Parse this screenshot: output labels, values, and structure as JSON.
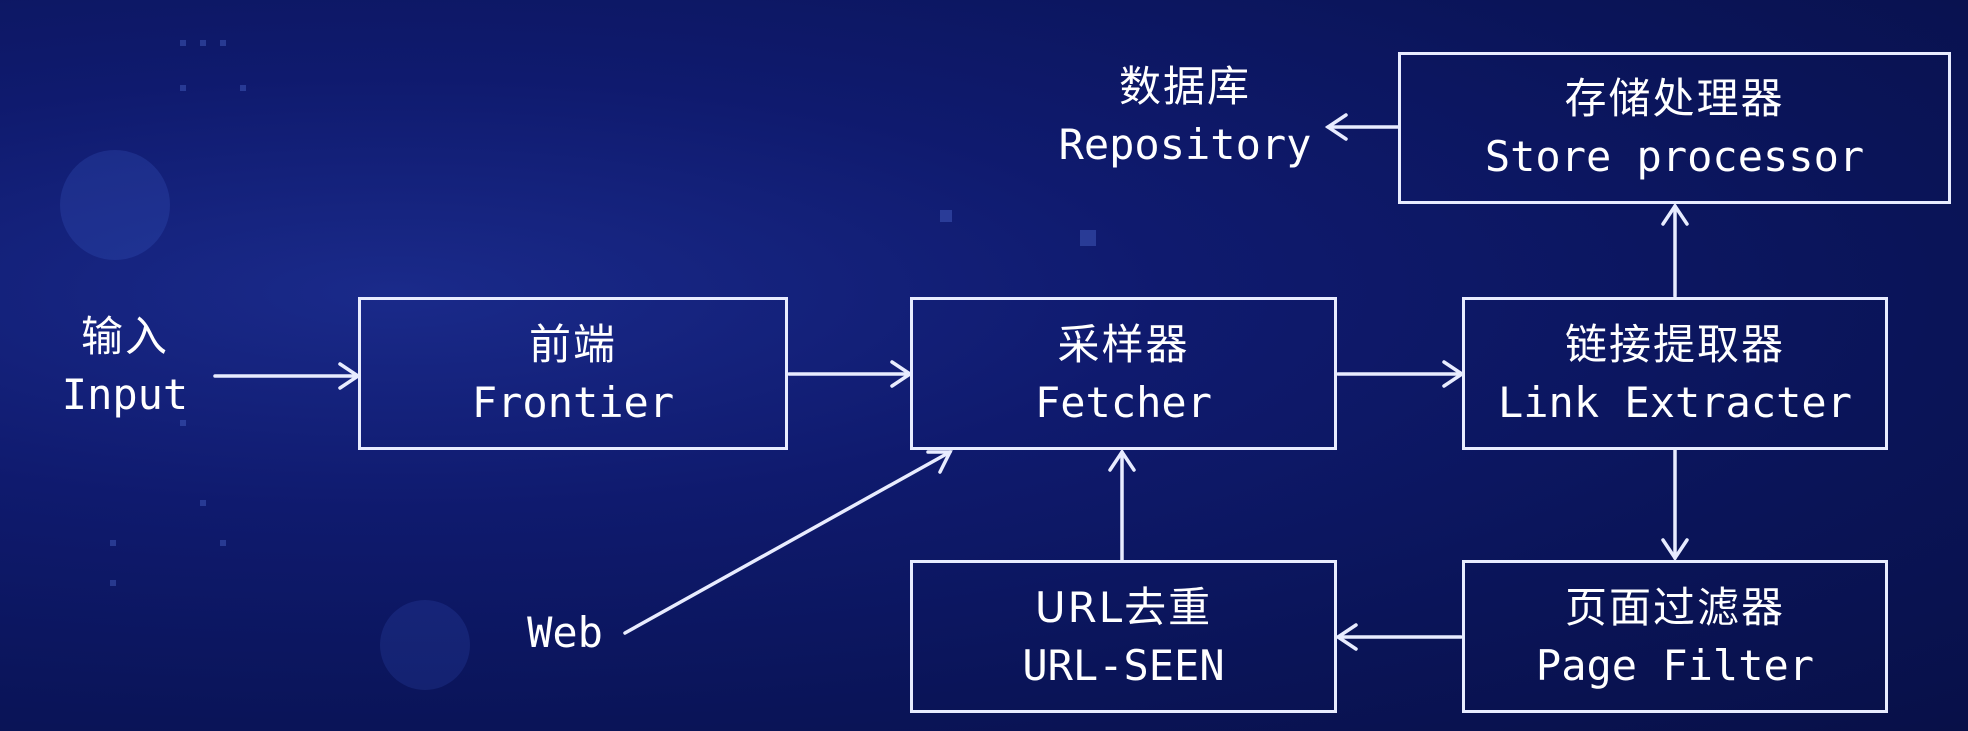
{
  "input": {
    "zh": "输入",
    "en": "Input"
  },
  "web": {
    "label": "Web"
  },
  "repository": {
    "zh": "数据库",
    "en": "Repository"
  },
  "frontier": {
    "zh": "前端",
    "en": "Frontier"
  },
  "fetcher": {
    "zh": "采样器",
    "en": "Fetcher"
  },
  "link_extracter": {
    "zh": "链接提取器",
    "en": "Link Extracter"
  },
  "store_processor": {
    "zh": "存储处理器",
    "en": "Store processor"
  },
  "url_seen": {
    "zh": "URL去重",
    "en": "URL-SEEN"
  },
  "page_filter": {
    "zh": "页面过滤器",
    "en": "Page Filter"
  },
  "colors": {
    "background": "#0f1a6e",
    "line": "#e8ecff"
  }
}
